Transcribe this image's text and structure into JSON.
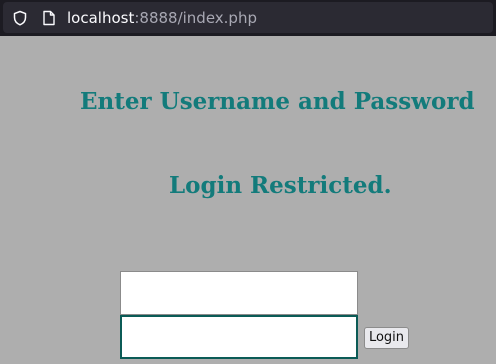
{
  "browser": {
    "url_host": "localhost",
    "url_port_path": ":8888/index.php",
    "icons": {
      "security": "shield-icon",
      "page": "page-icon"
    }
  },
  "page": {
    "heading": "Enter Username and Password",
    "subheading": "Login Restricted."
  },
  "form": {
    "username_value": "",
    "password_value": "",
    "login_label": "Login"
  },
  "colors": {
    "page_background": "#aeaeae",
    "heading_text": "#137b7b",
    "browser_bar": "#1c1b22",
    "url_field": "#2b2a33",
    "focused_input_border": "#0b5b56"
  }
}
